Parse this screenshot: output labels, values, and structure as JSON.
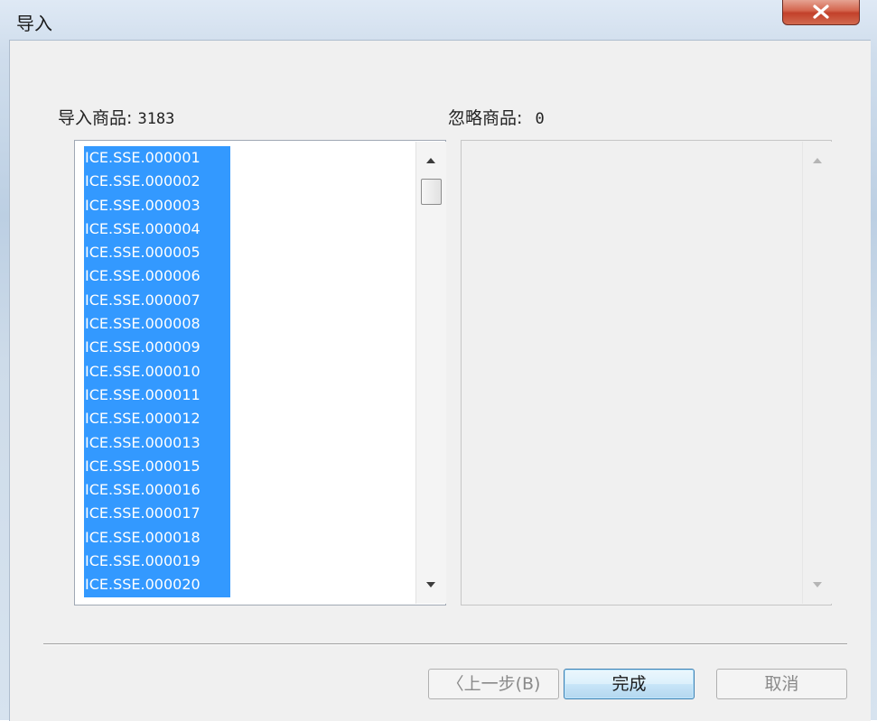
{
  "window": {
    "title": "导入"
  },
  "import_label": {
    "text": "导入商品:",
    "count": "3183"
  },
  "ignore_label": {
    "text": "忽略商品:",
    "count": "0"
  },
  "imported_list": [
    "ICE.SSE.000001",
    "ICE.SSE.000002",
    "ICE.SSE.000003",
    "ICE.SSE.000004",
    "ICE.SSE.000005",
    "ICE.SSE.000006",
    "ICE.SSE.000007",
    "ICE.SSE.000008",
    "ICE.SSE.000009",
    "ICE.SSE.000010",
    "ICE.SSE.000011",
    "ICE.SSE.000012",
    "ICE.SSE.000013",
    "ICE.SSE.000015",
    "ICE.SSE.000016",
    "ICE.SSE.000017",
    "ICE.SSE.000018",
    "ICE.SSE.000019",
    "ICE.SSE.000020"
  ],
  "buttons": {
    "back": "〈上一步(B)",
    "finish": "完成",
    "cancel": "取消"
  },
  "colors": {
    "selection": "#3399ff",
    "close_button": "#c2402a"
  },
  "icons": {
    "close": "close-x-icon",
    "scroll_up": "scroll-up-arrow-icon",
    "scroll_down": "scroll-down-arrow-icon"
  }
}
